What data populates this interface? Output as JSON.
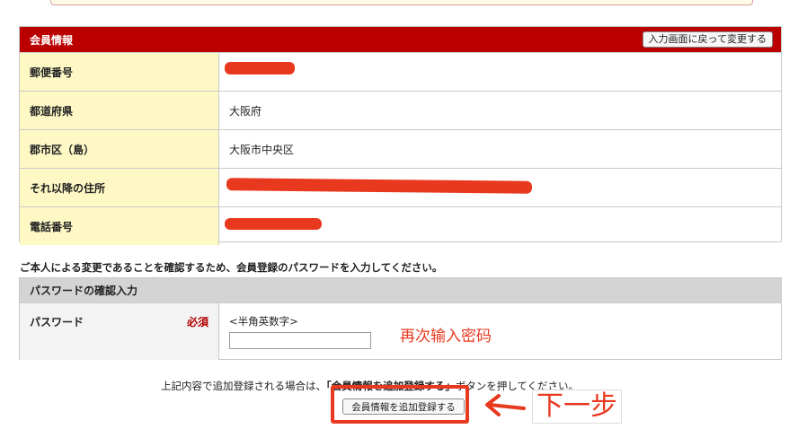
{
  "member": {
    "title": "会員情報",
    "back_button": "入力画面に戻って変更する",
    "rows": [
      {
        "label": "郵便番号",
        "value": ""
      },
      {
        "label": "都道府県",
        "value": "大阪府"
      },
      {
        "label": "郡市区（島）",
        "value": "大阪市中央区"
      },
      {
        "label": "それ以降の住所",
        "value": ""
      },
      {
        "label": "電話番号",
        "value": ""
      }
    ]
  },
  "confirm_text": "ご本人による変更であることを確認するため、会員登録のパスワードを入力してください。",
  "password": {
    "header": "パスワードの確認入力",
    "label": "パスワード",
    "required": "必須",
    "hint": "<半角英数字>",
    "value": "",
    "annotation": "再次输入密码"
  },
  "bottom": {
    "text_before": "上記内容で追加登録される場合は、",
    "text_bold": "「会員情報を追加登録する」",
    "text_after": "ボタンを押してください。",
    "submit_label": "会員情報を追加登録する",
    "annotation": "下一步"
  },
  "colors": {
    "header_red": "#bb0000",
    "label_yellow": "#fdf8c4",
    "annotation_red": "#e8391f"
  }
}
